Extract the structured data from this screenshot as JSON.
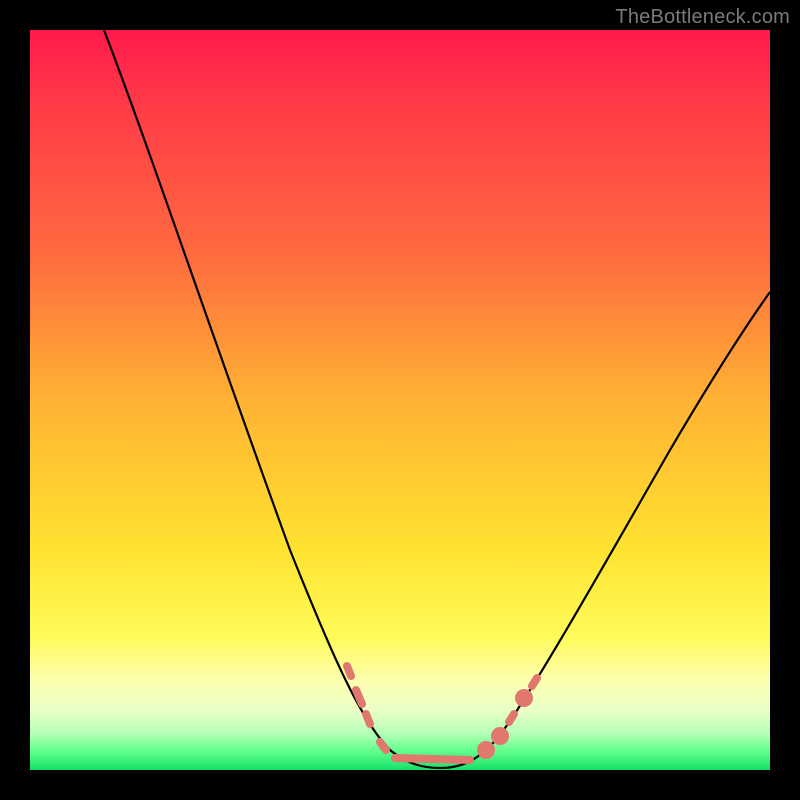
{
  "watermark": "TheBottleneck.com",
  "chart_data": {
    "type": "line",
    "title": "",
    "xlabel": "",
    "ylabel": "",
    "xlim": [
      0,
      100
    ],
    "ylim": [
      0,
      100
    ],
    "grid": false,
    "legend": false,
    "background_gradient": {
      "stops": [
        {
          "pct": 0,
          "color": "#ff1a4b"
        },
        {
          "pct": 30,
          "color": "#ff6a3f"
        },
        {
          "pct": 50,
          "color": "#ffb234"
        },
        {
          "pct": 70,
          "color": "#ffe22f"
        },
        {
          "pct": 88,
          "color": "#fdffb0"
        },
        {
          "pct": 95,
          "color": "#b6ffb6"
        },
        {
          "pct": 100,
          "color": "#16e06a"
        }
      ]
    },
    "series": [
      {
        "name": "bottleneck-curve",
        "color": "#000000",
        "x": [
          10,
          15,
          20,
          25,
          30,
          35,
          40,
          43,
          46,
          48,
          50,
          53,
          56,
          60,
          63,
          68,
          75,
          82,
          90,
          100
        ],
        "y": [
          100,
          88,
          76,
          64,
          52,
          40,
          28,
          18,
          10,
          5,
          2,
          1,
          1,
          2,
          6,
          14,
          26,
          38,
          50,
          62
        ]
      }
    ],
    "markers": {
      "name": "highlight-dots",
      "color": "#e0786d",
      "x": [
        42,
        43,
        45,
        48,
        50,
        52,
        54,
        56,
        58,
        60,
        62,
        64
      ],
      "y": [
        15,
        11,
        6,
        3,
        2,
        2,
        2,
        2,
        2.5,
        4,
        8,
        12
      ]
    }
  }
}
